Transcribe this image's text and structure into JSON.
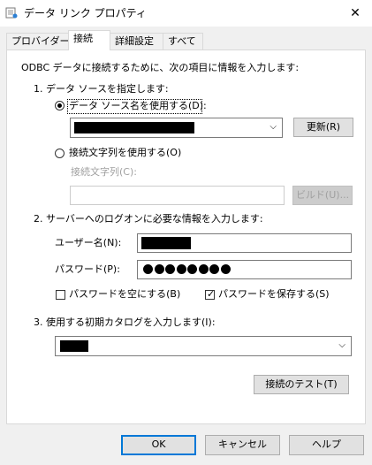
{
  "window": {
    "title": "データ リンク プロパティ",
    "close_glyph": "✕"
  },
  "tabs": [
    {
      "label": "プロバイダー",
      "active": false
    },
    {
      "label": "接続",
      "active": true
    },
    {
      "label": "詳細設定",
      "active": false
    },
    {
      "label": "すべて",
      "active": false
    }
  ],
  "intro": "ODBC データに接続するために、次の項目に情報を入力します:",
  "step1": {
    "heading": "1. データ ソースを指定します:",
    "use_dsn_label": "データ ソース名を使用する(D):",
    "use_dsn_checked": true,
    "refresh_button": "更新(R)",
    "use_connstr_label": "接続文字列を使用する(O)",
    "use_connstr_checked": false,
    "connstr_label": "接続文字列(C):",
    "build_button": "ビルド(U)..."
  },
  "step2": {
    "heading": "2. サーバーへのログオンに必要な情報を入力します:",
    "username_label": "ユーザー名(N):",
    "password_label": "パスワード(P):",
    "password_mask_count": 8,
    "blank_password_label": "パスワードを空にする(B)",
    "blank_password_checked": false,
    "save_password_label": "パスワードを保存する(S)",
    "save_password_checked": true
  },
  "step3": {
    "heading": "3. 使用する初期カタログを入力します(I):"
  },
  "test_button": "接続のテスト(T)",
  "footer": {
    "ok": "OK",
    "cancel": "キャンセル",
    "help": "ヘルプ"
  },
  "icons": {
    "dropdown": "chevron-down-icon",
    "checkmark": "✓"
  }
}
